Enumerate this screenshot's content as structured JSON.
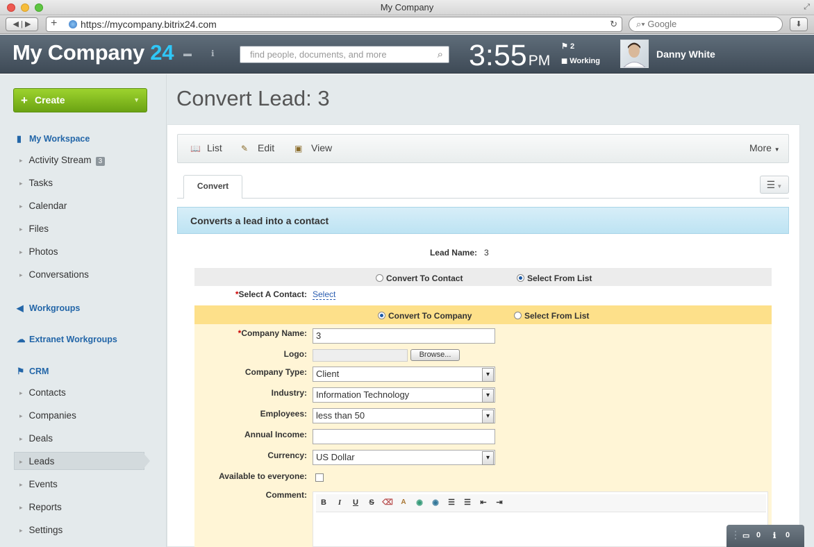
{
  "browser": {
    "window_title": "My Company",
    "url": "https://mycompany.bitrix24.com",
    "search_placeholder": "Google"
  },
  "header": {
    "logo_text": "My Company",
    "logo_number": "24",
    "search_placeholder": "find people, documents, and more",
    "clock_time": "3:55",
    "clock_ampm": "PM",
    "tasks_count": "2",
    "work_status": "Working",
    "user_name": "Danny White"
  },
  "sidebar": {
    "create_label": "Create",
    "my_workspace": "My Workspace",
    "workspace_items": [
      {
        "label": "Activity Stream",
        "badge": "3"
      },
      {
        "label": "Tasks"
      },
      {
        "label": "Calendar"
      },
      {
        "label": "Files"
      },
      {
        "label": "Photos"
      },
      {
        "label": "Conversations"
      }
    ],
    "workgroups": "Workgroups",
    "extranet": "Extranet Workgroups",
    "crm": "CRM",
    "crm_items": [
      {
        "label": "Contacts"
      },
      {
        "label": "Companies"
      },
      {
        "label": "Deals"
      },
      {
        "label": "Leads"
      },
      {
        "label": "Events"
      },
      {
        "label": "Reports"
      },
      {
        "label": "Settings"
      }
    ]
  },
  "main": {
    "page_title": "Convert Lead: 3",
    "toolbar": {
      "list": "List",
      "edit": "Edit",
      "view": "View",
      "more": "More"
    },
    "tab_convert": "Convert",
    "info_text": "Converts a lead into a contact",
    "lead_name_label": "Lead Name:",
    "lead_name_value": "3",
    "contact_option_convert": "Convert To Contact",
    "contact_option_select": "Select From List",
    "select_contact_label": "Select A Contact:",
    "select_link": "Select",
    "company_option_convert": "Convert To Company",
    "company_option_select": "Select From List",
    "form": {
      "company_name_label": "Company Name:",
      "company_name_value": "3",
      "logo_label": "Logo:",
      "browse_label": "Browse...",
      "company_type_label": "Company Type:",
      "company_type_value": "Client",
      "industry_label": "Industry:",
      "industry_value": "Information Technology",
      "employees_label": "Employees:",
      "employees_value": "less than 50",
      "annual_income_label": "Annual Income:",
      "annual_income_value": "",
      "currency_label": "Currency:",
      "currency_value": "US Dollar",
      "available_label": "Available to everyone:",
      "comment_label": "Comment:"
    }
  },
  "widget": {
    "messages_count": "0",
    "notifications_count": "0"
  }
}
